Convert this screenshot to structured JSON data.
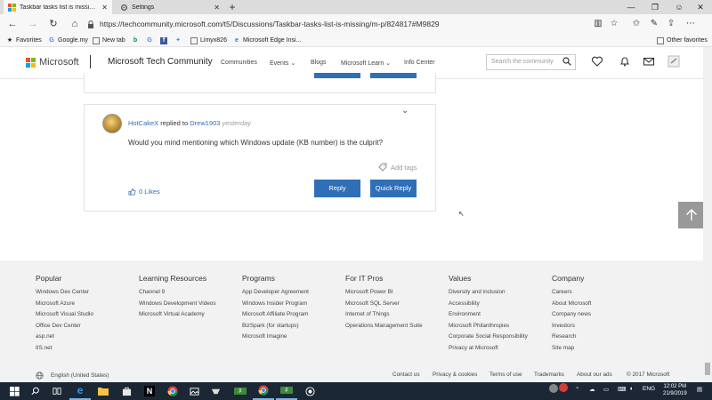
{
  "browser": {
    "tabs": [
      {
        "label": "Taskbar tasks list is missing - Mi",
        "active": true
      },
      {
        "label": "Settings",
        "active": false
      }
    ],
    "url": "https://techcommunity.microsoft.com/t5/Discussions/Taskbar-tasks-list-is-missing/m-p/824817#M9829",
    "favorites_label": "Favorites",
    "bookmarks": [
      "Google.my",
      "New tab",
      "G",
      "",
      "",
      "Limyx826",
      "Microsoft Edge Insi..."
    ],
    "other_favorites": "Other favorites"
  },
  "header": {
    "brand": "Microsoft",
    "site_title": "Microsoft Tech Community",
    "nav": [
      "Communities",
      "Events",
      "Blogs",
      "Microsoft Learn",
      "Info Center"
    ],
    "search_placeholder": "Search the community"
  },
  "post": {
    "author": "HotCakeX",
    "replied_to_text": "replied to",
    "replied_to": "Drew1903",
    "when": "yesterday",
    "body": "Would you mind mentioning which Windows update (KB number) is the culprit?",
    "add_tags": "Add tags",
    "likes": "0 Likes",
    "reply_label": "Reply",
    "quick_reply_label": "Quick Reply"
  },
  "footer": {
    "columns": [
      {
        "heading": "Popular",
        "links": [
          "Windows Dev Center",
          "Microsoft Azure",
          "Microsoft Visual Studio",
          "Office Dev Center",
          "asp.net",
          "IIS.net"
        ]
      },
      {
        "heading": "Learning Resources",
        "links": [
          "Channel 9",
          "Windows Development Videos",
          "Microsoft Virtual Academy"
        ]
      },
      {
        "heading": "Programs",
        "links": [
          "App Developer Agreement",
          "Windows Insider Program",
          "Microsoft Affiliate Program",
          "BizSpark (for startups)",
          "Microsoft Imagine"
        ]
      },
      {
        "heading": "For IT Pros",
        "links": [
          "Microsoft Power BI",
          "Microsoft SQL Server",
          "Internet of Things",
          "Operations Management Suite"
        ]
      },
      {
        "heading": "Values",
        "links": [
          "Diversity and inclusion",
          "Accessibility",
          "Environment",
          "Microsoft Philanthropies",
          "Corporate Social Responsibility",
          "Privacy at Microsoft"
        ]
      },
      {
        "heading": "Company",
        "links": [
          "Careers",
          "About Microsoft",
          "Company news",
          "Investors",
          "Research",
          "Site map"
        ]
      }
    ],
    "locale": "English (United States)",
    "bottom_links": [
      "Contact us",
      "Privacy & cookies",
      "Terms of use",
      "Trademarks",
      "About our ads"
    ],
    "copyright": "© 2017 Microsoft"
  },
  "taskbar": {
    "time": "12:02 PM",
    "date": "21/9/2019",
    "language": "ENG"
  },
  "colors": {
    "accent": "#2f6fb7",
    "footer_bg": "#f2f2f2",
    "taskbar_bg": "#1c2735"
  }
}
